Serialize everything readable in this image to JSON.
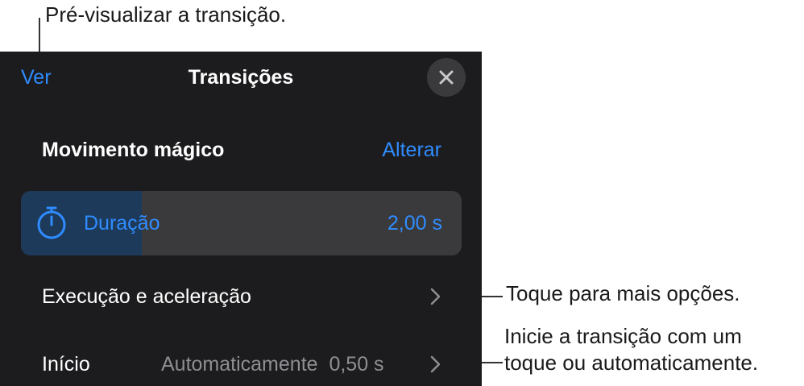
{
  "callouts": {
    "preview": "Pré-visualizar a transição.",
    "more_options": "Toque para mais opções.",
    "start_line1": "Inicie a transição com um",
    "start_line2": "toque ou automaticamente."
  },
  "header": {
    "preview_label": "Ver",
    "title": "Transições"
  },
  "transition": {
    "name": "Movimento mágico",
    "change_label": "Alterar"
  },
  "duration": {
    "label": "Duração",
    "value": "2,00 s",
    "slider_fraction": 0.274
  },
  "rows": {
    "delivery_label": "Execução e aceleração",
    "start_label": "Início",
    "start_mode": "Automaticamente",
    "start_delay": "0,50 s"
  },
  "colors": {
    "accent": "#2f8cff",
    "panel": "#1c1c1e",
    "control": "#3a3a3c",
    "secondary_text": "#8e8e93"
  }
}
